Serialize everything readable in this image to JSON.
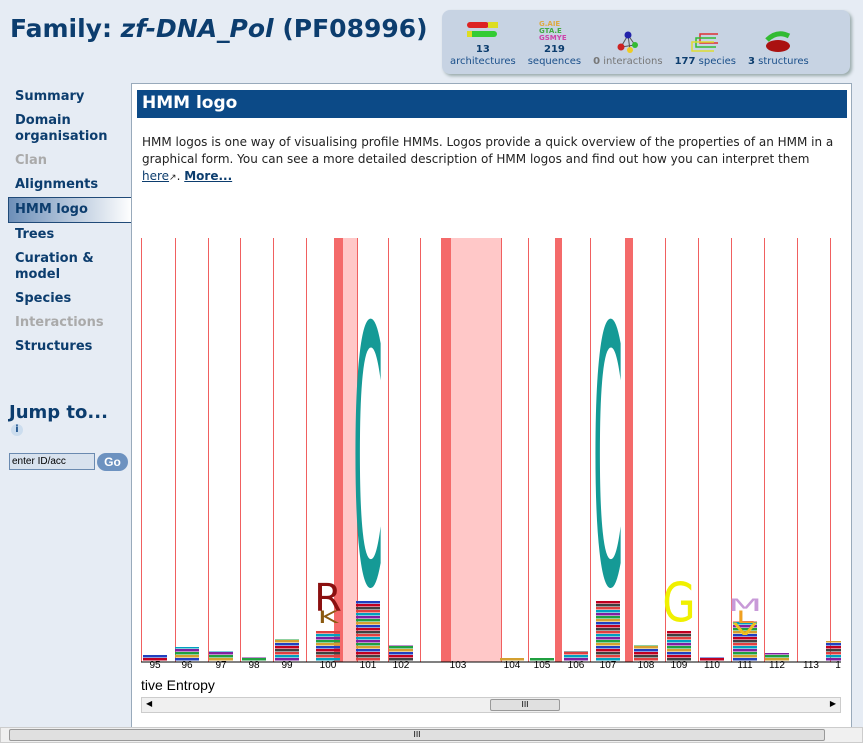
{
  "title": {
    "prefix": "Family: ",
    "name": "zf-DNA_Pol",
    "acc": "(PF08996)"
  },
  "stats": [
    {
      "count": "13",
      "label": "architectures",
      "icon": "architectures-icon"
    },
    {
      "count": "219",
      "label": "sequences",
      "icon": "sequences-icon"
    },
    {
      "count": "0",
      "label": "interactions",
      "icon": "interactions-icon"
    },
    {
      "count": "177",
      "label": "species",
      "icon": "species-icon"
    },
    {
      "count": "3",
      "label": "structures",
      "icon": "structures-icon"
    }
  ],
  "nav": [
    {
      "label": "Summary",
      "state": "normal"
    },
    {
      "label": "Domain organisation",
      "state": "normal"
    },
    {
      "label": "Clan",
      "state": "disabled"
    },
    {
      "label": "Alignments",
      "state": "normal"
    },
    {
      "label": "HMM logo",
      "state": "active"
    },
    {
      "label": "Trees",
      "state": "normal"
    },
    {
      "label": "Curation & model",
      "state": "normal"
    },
    {
      "label": "Species",
      "state": "normal"
    },
    {
      "label": "Interactions",
      "state": "disabled"
    },
    {
      "label": "Structures",
      "state": "normal"
    }
  ],
  "jump": {
    "title": "Jump to...",
    "input_value": "enter ID/acc",
    "go": "Go"
  },
  "main": {
    "header": "HMM logo",
    "desc": "HMM logos is one way of visualising profile HMMs. Logos provide a quick overview of the properties of an HMM in a graphical form. You can see a more detailed description of HMM logos and find out how you can interpret them ",
    "here": "here",
    "more": "More...",
    "y_label": "tive Entropy"
  },
  "logo": {
    "columns": [
      "95",
      "96",
      "97",
      "98",
      "99",
      "100",
      "101",
      "102",
      "",
      "103",
      "104",
      "105",
      "106",
      "107",
      "108",
      "109",
      "110",
      "111",
      "112",
      "113",
      "1"
    ],
    "letters": [
      {
        "col": "100",
        "char": "R",
        "color": "#8b1010"
      },
      {
        "col": "100",
        "char": "K",
        "color": "#8b5a10"
      },
      {
        "col": "101",
        "char": "C",
        "color": "#159a96"
      },
      {
        "col": "107",
        "char": "C",
        "color": "#159a96"
      },
      {
        "col": "109",
        "char": "G",
        "color": "#f0f000"
      },
      {
        "col": "111",
        "char": "M",
        "color": "#c89ad8"
      },
      {
        "col": "111",
        "char": "L",
        "color": "#f0a020"
      },
      {
        "col": "111",
        "char": "V",
        "color": "#f0c020"
      }
    ],
    "colors": {
      "boundary": "#f06060",
      "insert": "#ffc8c8",
      "insert_strong": "#f46a6a"
    }
  }
}
